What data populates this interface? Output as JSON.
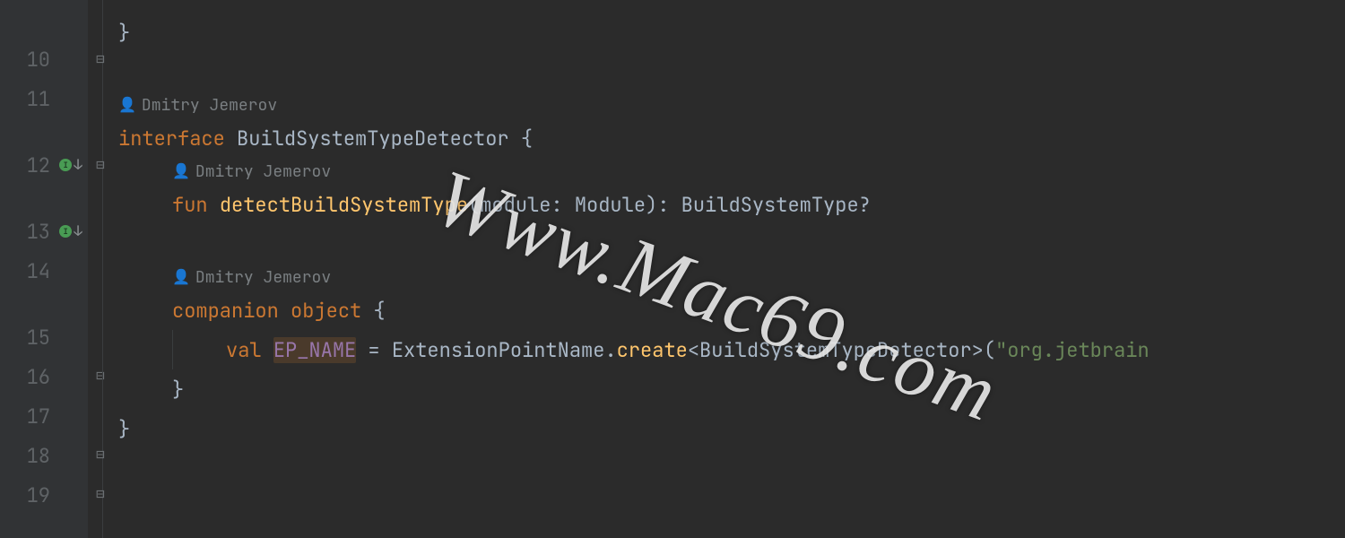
{
  "gutter": {
    "lines": [
      "",
      "10",
      "11",
      "",
      "12",
      "",
      "13",
      "14",
      "",
      "15",
      "16",
      "17",
      "18",
      "19"
    ]
  },
  "icons": {
    "impl": "I",
    "down": "↓",
    "person": "👤"
  },
  "annotations": {
    "author1": "Dmitry Jemerov",
    "author2": "Dmitry Jemerov",
    "author3": "Dmitry Jemerov"
  },
  "code": {
    "line9_partial": "...",
    "line10_brace": "}",
    "kw_interface": "interface ",
    "iface_name": "BuildSystemTypeDetector ",
    "brace_open": "{",
    "kw_fun": "fun ",
    "fn_name": "detectBuildSystemType",
    "paren_open": "(",
    "param_name": "module",
    "colon_sp": ": ",
    "param_type": "Module",
    "paren_close": ")",
    "ret_colon": ": ",
    "ret_type": "BuildSystemType?",
    "kw_companion": "companion ",
    "kw_object": "object ",
    "kw_val": "val ",
    "prop_name": "EP_NAME",
    "eq": " = ",
    "epClass": "ExtensionPointName",
    "dot": ".",
    "create": "create",
    "lt": "<",
    "gtype": "BuildSystemTypeDetector",
    "gt": ">",
    "po": "(",
    "str_partial": "\"org.jetbrain",
    "brace_close": "}",
    "brace_close2": "}"
  },
  "watermark": "Www.Mac69.com"
}
